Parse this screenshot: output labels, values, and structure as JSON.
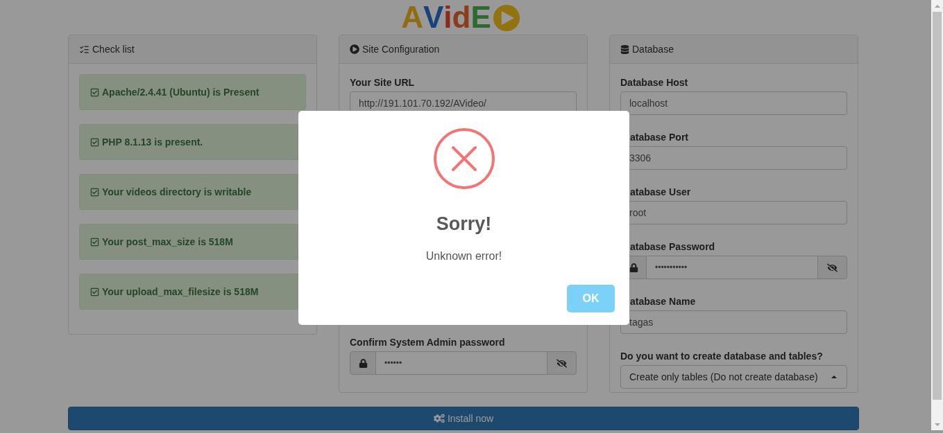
{
  "logo": {
    "text": "AVidE"
  },
  "checklist": {
    "title": "Check list",
    "items": [
      {
        "text": "Apache/2.4.41 (Ubuntu) is Present"
      },
      {
        "text": "PHP 8.1.13 is present."
      },
      {
        "text": "Your videos directory is writable"
      },
      {
        "text": "Your post_max_size is 518M"
      },
      {
        "text": "Your upload_max_filesize is 518M"
      }
    ]
  },
  "site_configuration": {
    "title": "Site Configuration",
    "fields": [
      {
        "kind": "text",
        "label": "Your Site URL",
        "value": "http://191.101.70.192/AVideo/"
      },
      {
        "kind": "spacer"
      },
      {
        "kind": "password",
        "label": "Confirm System Admin password",
        "value": "••••••"
      }
    ]
  },
  "database": {
    "title": "Database",
    "fields": [
      {
        "kind": "text",
        "label": "Database Host",
        "value": "localhost"
      },
      {
        "kind": "text",
        "label": "atabase Port",
        "value": "3306",
        "label_covered": true
      },
      {
        "kind": "text",
        "label": "atabase User",
        "value": "root",
        "label_covered": true
      },
      {
        "kind": "password",
        "label": "atabase Password",
        "value": "•••••••••••",
        "label_covered": true
      },
      {
        "kind": "text",
        "label": "atabase Name",
        "value": "tagas",
        "label_covered": true
      },
      {
        "kind": "select",
        "label": "Do you want to create database and tables?",
        "value": "Create only tables (Do not create database)"
      }
    ]
  },
  "install_button": {
    "label": "Install now"
  },
  "dialog": {
    "kind": "error",
    "title": "Sorry!",
    "message": "Unknown error!",
    "button": "OK"
  }
}
